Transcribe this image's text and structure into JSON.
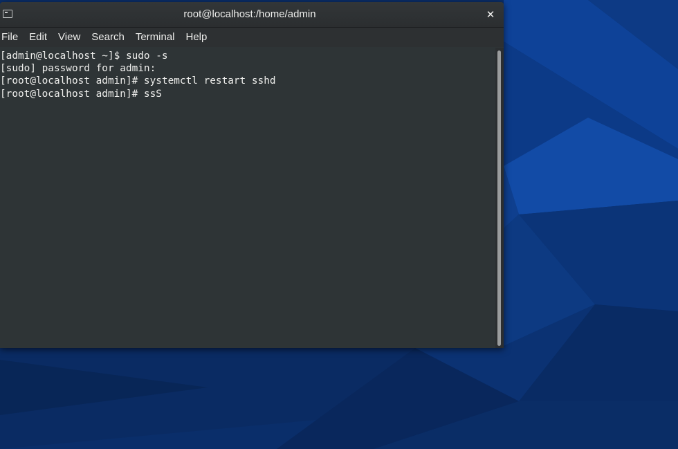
{
  "window": {
    "title": "root@localhost:/home/admin",
    "icon": "terminal-icon",
    "close_glyph": "✕"
  },
  "menu": {
    "items": [
      {
        "label": "File"
      },
      {
        "label": "Edit"
      },
      {
        "label": "View"
      },
      {
        "label": "Search"
      },
      {
        "label": "Terminal"
      },
      {
        "label": "Help"
      }
    ]
  },
  "terminal": {
    "lines": [
      "[admin@localhost ~]$ sudo -s",
      "[sudo] password for admin:",
      "[root@localhost admin]# systemctl restart sshd",
      "[root@localhost admin]# ssS"
    ]
  },
  "colors": {
    "terminal_bg": "#2e3436",
    "terminal_fg": "#eeeeec",
    "desktop_bg": "#0b2f6d"
  }
}
